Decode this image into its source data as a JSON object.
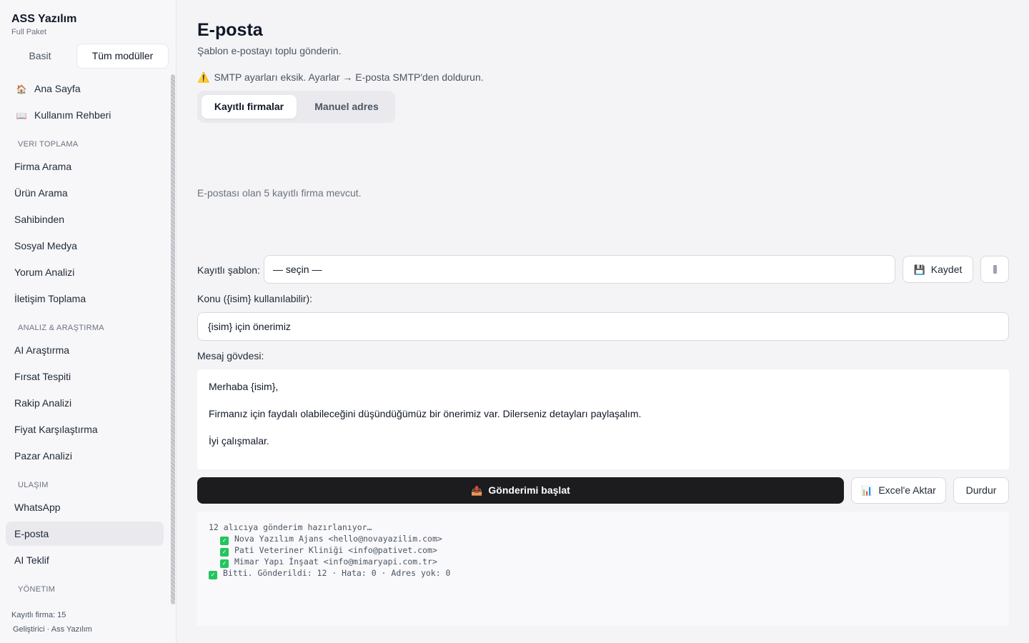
{
  "brand": {
    "title": "ASS Yazılım",
    "subtitle": "Full Paket"
  },
  "mode_tabs": {
    "basic": "Basit",
    "all": "Tüm modüller"
  },
  "nav": {
    "home": "Ana Sayfa",
    "guide": "Kullanım Rehberi",
    "section_data": "VERI TOPLAMA",
    "firma_arama": "Firma Arama",
    "urun_arama": "Ürün Arama",
    "sahibinden": "Sahibinden",
    "sosyal_medya": "Sosyal Medya",
    "yorum_analizi": "Yorum Analizi",
    "iletisim_toplama": "İletişim Toplama",
    "section_analysis": "ANALIZ & ARAŞTIRMA",
    "ai_arastirma": "AI Araştırma",
    "firsat_tespiti": "Fırsat Tespiti",
    "rakip_analizi": "Rakip Analizi",
    "fiyat_karsilastirma": "Fiyat Karşılaştırma",
    "pazar_analizi": "Pazar Analizi",
    "section_outreach": "ULAŞIM",
    "whatsapp": "WhatsApp",
    "eposta": "E-posta",
    "ai_teklif": "AI Teklif",
    "section_admin": "YÖNETIM"
  },
  "footer": {
    "saved_firms": "Kayıtlı firma: 15",
    "developer": "Geliştirici · Ass Yazılım"
  },
  "page": {
    "title": "E-posta",
    "subtitle": "Şablon e-postayı toplu gönderin.",
    "warning": "SMTP ayarları eksik. Ayarlar → E-posta SMTP'den doldurun.",
    "tabs": {
      "saved": "Kayıtlı firmalar",
      "manual": "Manuel adres"
    },
    "available": "E-postası olan 5 kayıtlı firma mevcut.",
    "template_label": "Kayıtlı şablon:",
    "template_value": "— seçin —",
    "save_button": "Kaydet",
    "subject_label": "Konu ({isim} kullanılabilir):",
    "subject_value": "{isim} için önerimiz",
    "body_label": "Mesaj gövdesi:",
    "body_lines": [
      "Merhaba {isim},",
      "Firmanız için faydalı olabileceğini düşündüğümüz bir önerimiz var. Dilerseniz detayları paylaşalım.",
      "İyi çalışmalar."
    ],
    "start_button": "Gönderimi başlat",
    "export_button": "Excel'e Aktar",
    "stop_button": "Durdur",
    "log": [
      "12 alıcıya gönderim hazırlanıyor…",
      "Nova Yazılım Ajans <hello@novayazilim.com>",
      "Pati Veteriner Kliniği <info@pativet.com>",
      "Mimar Yapı İnşaat <info@mimaryapi.com.tr>",
      "Bitti. Gönderildi: 12 · Hata: 0 · Adres yok: 0"
    ]
  },
  "colors": {
    "primary": "#1c1c1f",
    "success": "#22c55e",
    "active_nav": "#e9e9ee"
  }
}
